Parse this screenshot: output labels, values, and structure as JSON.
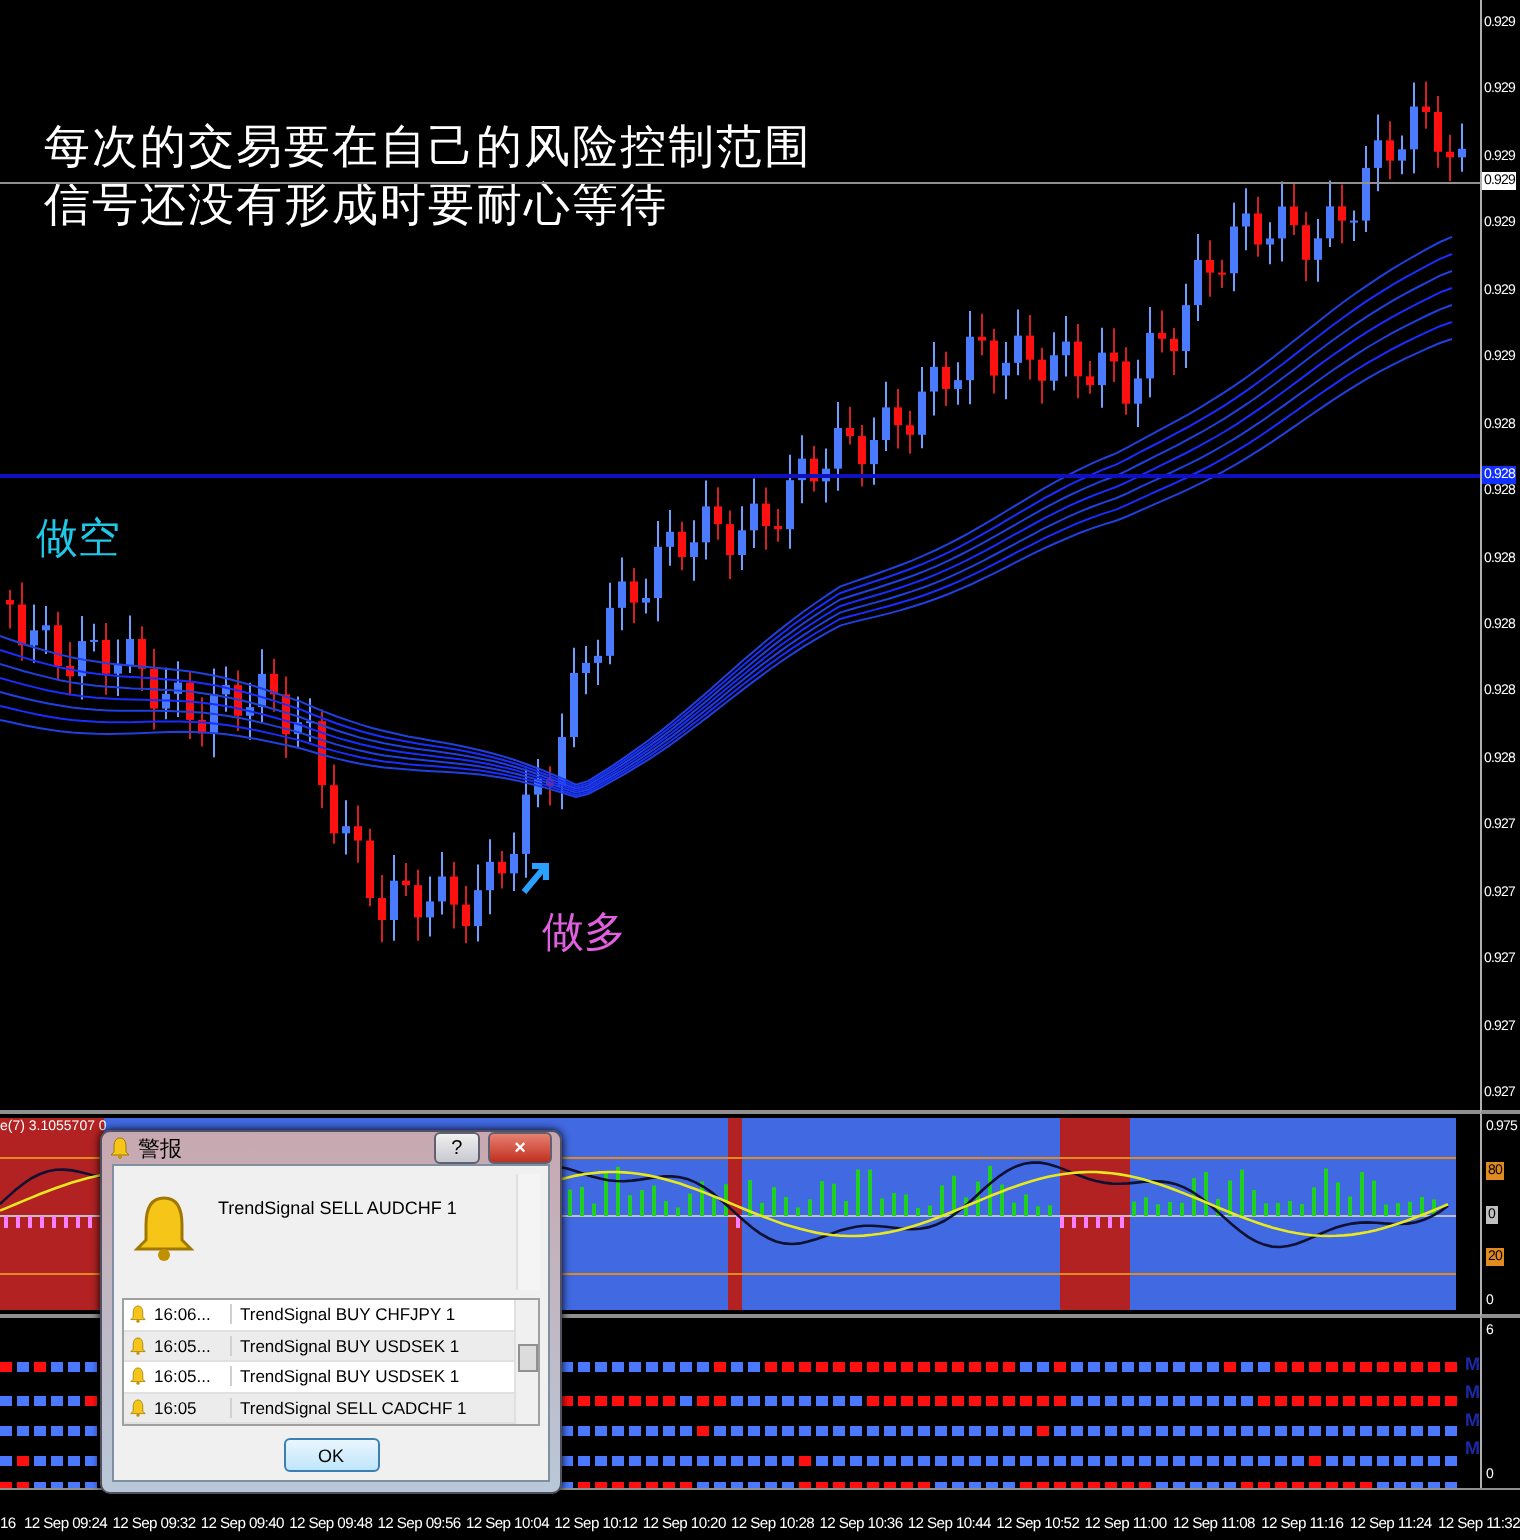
{
  "main_chart": {
    "notes": [
      "每次的交易要在自己的风险控制范围",
      "信号还没有形成时要耐心等待"
    ],
    "signals": [
      {
        "kind": "short",
        "text": "做空"
      },
      {
        "kind": "long",
        "text": "做多"
      }
    ],
    "price_axis": [
      "0.929",
      "0.929",
      "0.929",
      "0.929",
      "0.929",
      "0.929",
      "0.928",
      "0.928",
      "0.928",
      "0.928",
      "0.928",
      "0.928",
      "0.927",
      "0.927",
      "0.927",
      "0.927",
      "0.927"
    ],
    "current_price": "0.929",
    "line_price": "0.928"
  },
  "oscillator": {
    "caption": "e(7) 3.1055707 0",
    "axis": [
      {
        "kind": "plain",
        "text": "0.975"
      },
      {
        "kind": "level",
        "text": "80"
      },
      {
        "kind": "mid",
        "text": "0"
      },
      {
        "kind": "level",
        "text": "20"
      },
      {
        "kind": "plain",
        "text": "0"
      }
    ]
  },
  "signal_panel": {
    "axis": [
      "6",
      "0"
    ],
    "markers": [
      "M",
      "M",
      "M",
      "M"
    ]
  },
  "time_axis": [
    "16",
    "12 Sep 09:24",
    "12 Sep 09:32",
    "12 Sep 09:40",
    "12 Sep 09:48",
    "12 Sep 09:56",
    "12 Sep 10:04",
    "12 Sep 10:12",
    "12 Sep 10:20",
    "12 Sep 10:28",
    "12 Sep 10:36",
    "12 Sep 10:44",
    "12 Sep 10:52",
    "12 Sep 11:00",
    "12 Sep 11:08",
    "12 Sep 11:16",
    "12 Sep 11:24",
    "12 Sep 11:32"
  ],
  "alert_dialog": {
    "title": "警报",
    "help_button": "?",
    "close_button": "×",
    "message": "TrendSignal SELL  AUDCHF  1",
    "history": [
      {
        "time": "16:06...",
        "text": "TrendSignal BUY  CHFJPY  1"
      },
      {
        "time": "16:05...",
        "text": "TrendSignal BUY  USDSEK  1"
      },
      {
        "time": "16:05...",
        "text": "TrendSignal BUY  USDSEK  1"
      },
      {
        "time": "16:05",
        "text": "TrendSignal SELL  CADCHF  1"
      }
    ],
    "ok_button": "OK"
  }
}
